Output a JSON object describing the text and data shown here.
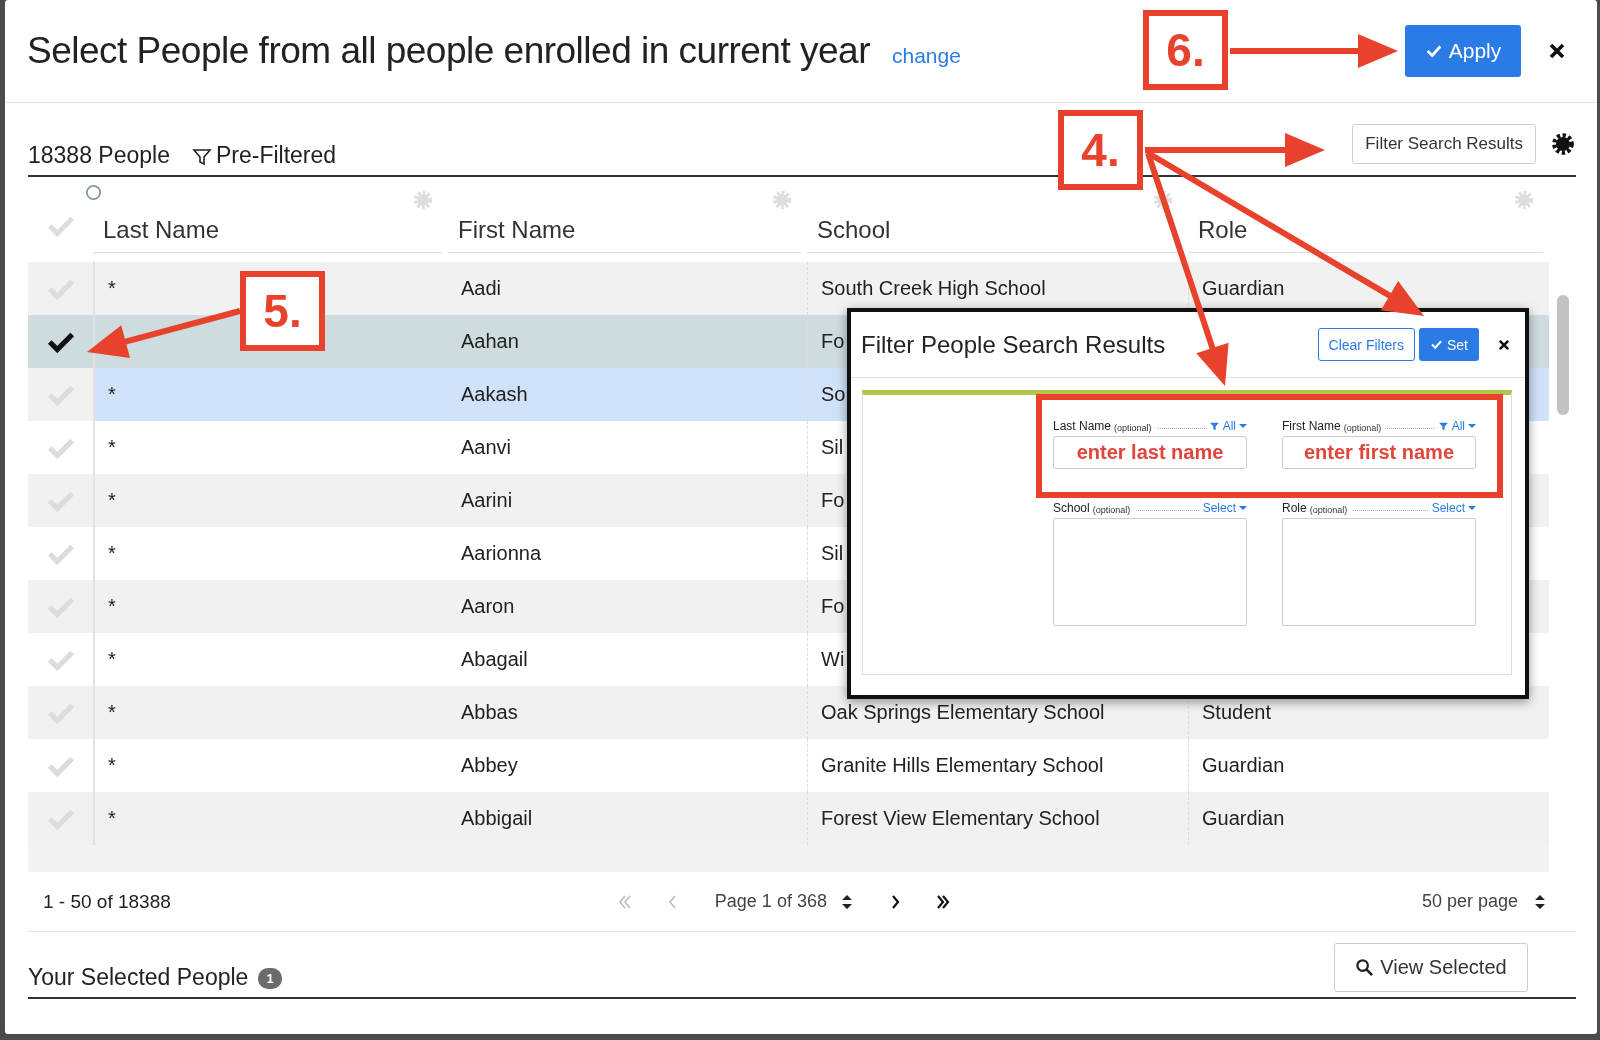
{
  "dialog": {
    "title": "Select People from all people enrolled in current year",
    "change_link": "change",
    "apply_button": "Apply"
  },
  "results_bar": {
    "count": "18388 People",
    "filter_status": "Pre-Filtered",
    "filter_button": "Filter Search Results"
  },
  "table": {
    "columns": [
      "Last Name",
      "First Name",
      "School",
      "Role"
    ],
    "rows": [
      {
        "last_name": "*",
        "first_name": "Aadi",
        "school": "South Creek High School",
        "role": "Guardian",
        "checked": false,
        "highlighted": false
      },
      {
        "first_name": "Aahan",
        "school": "Fo",
        "checked": true,
        "highlighted": false
      },
      {
        "last_name": "*",
        "first_name": "Aakash",
        "school": "So",
        "checked": false,
        "highlighted": true
      },
      {
        "last_name": "*",
        "first_name": "Aanvi",
        "school": "Sil",
        "checked": false,
        "highlighted": false
      },
      {
        "last_name": "*",
        "first_name": "Aarini",
        "school": "Fo",
        "checked": false,
        "highlighted": false
      },
      {
        "last_name": "*",
        "first_name": "Aarionna",
        "school": "Sil",
        "checked": false,
        "highlighted": false
      },
      {
        "last_name": "*",
        "first_name": "Aaron",
        "school": "Fo",
        "checked": false,
        "highlighted": false
      },
      {
        "last_name": "*",
        "first_name": "Abagail",
        "school": "Wi",
        "checked": false,
        "highlighted": false
      },
      {
        "last_name": "*",
        "first_name": "Abbas",
        "school": "Oak Springs Elementary School",
        "role": "Student",
        "checked": false,
        "highlighted": false
      },
      {
        "last_name": "*",
        "first_name": "Abbey",
        "school": "Granite Hills Elementary School",
        "role": "Guardian",
        "checked": false,
        "highlighted": false
      },
      {
        "last_name": "*",
        "first_name": "Abbigail",
        "school": "Forest View Elementary School",
        "role": "Guardian",
        "checked": false,
        "highlighted": false
      }
    ]
  },
  "pagination": {
    "range": "1 - 50 of 18388",
    "page": "Page 1 of 368",
    "per_page": "50 per page"
  },
  "selected_section": {
    "title": "Your Selected People",
    "count_badge": "1",
    "view_button": "View Selected"
  },
  "filter_popup": {
    "title": "Filter People Search Results",
    "clear_button": "Clear Filters",
    "set_button": "Set",
    "fields": [
      {
        "kind": "text",
        "label": "Last Name",
        "hint": "(optional)",
        "action": "All",
        "placeholder": "enter last name"
      },
      {
        "kind": "text",
        "label": "First Name",
        "hint": "(optional)",
        "action": "All",
        "placeholder": "enter first name"
      },
      {
        "kind": "list",
        "label": "School",
        "hint": "(optional)",
        "action": "Select"
      },
      {
        "kind": "list",
        "label": "Role",
        "hint": "(optional)",
        "action": "Select"
      }
    ]
  },
  "callouts": [
    {
      "label": "6."
    },
    {
      "label": "4."
    },
    {
      "label": "5."
    }
  ]
}
